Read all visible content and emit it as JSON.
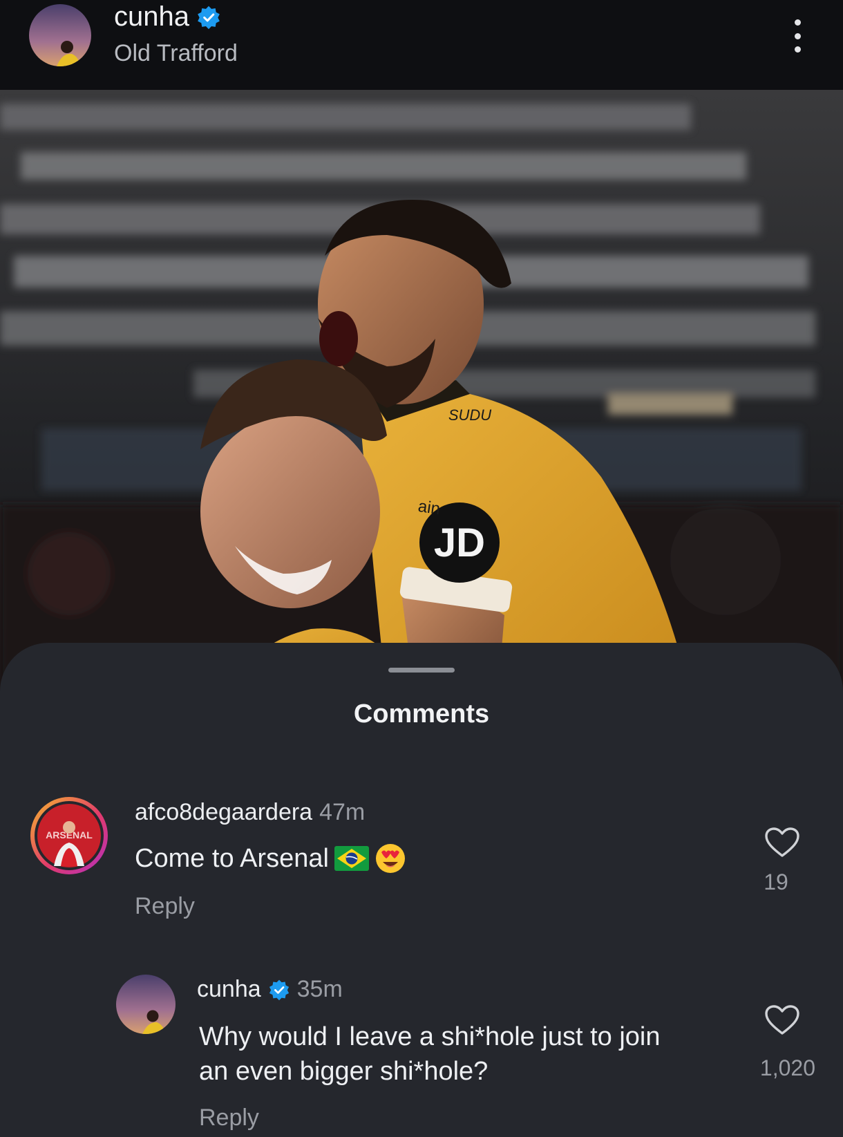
{
  "post": {
    "username": "cunha",
    "location": "Old Trafford",
    "photo_text": {
      "sponsor_top": "SUDU",
      "sponsor_logo": "JD",
      "armband": "ain"
    }
  },
  "sheet": {
    "title": "Comments"
  },
  "comments": [
    {
      "username": "afco8degaardera",
      "time": "47m",
      "text": "Come to Arsenal",
      "emojis": [
        "brazil-flag",
        "heart-eyes"
      ],
      "reply_label": "Reply",
      "likes": "19"
    },
    {
      "username": "cunha",
      "time": "35m",
      "verified": true,
      "text_line1": "Why would I leave a shi*hole just to join",
      "text_line2": "an even bigger shi*hole?",
      "reply_label": "Reply",
      "likes": "1,020"
    }
  ],
  "colors": {
    "background": "#0d0e11",
    "sheet": "#25272d",
    "verified": "#1d9bf0",
    "jersey": "#e0a32a"
  }
}
